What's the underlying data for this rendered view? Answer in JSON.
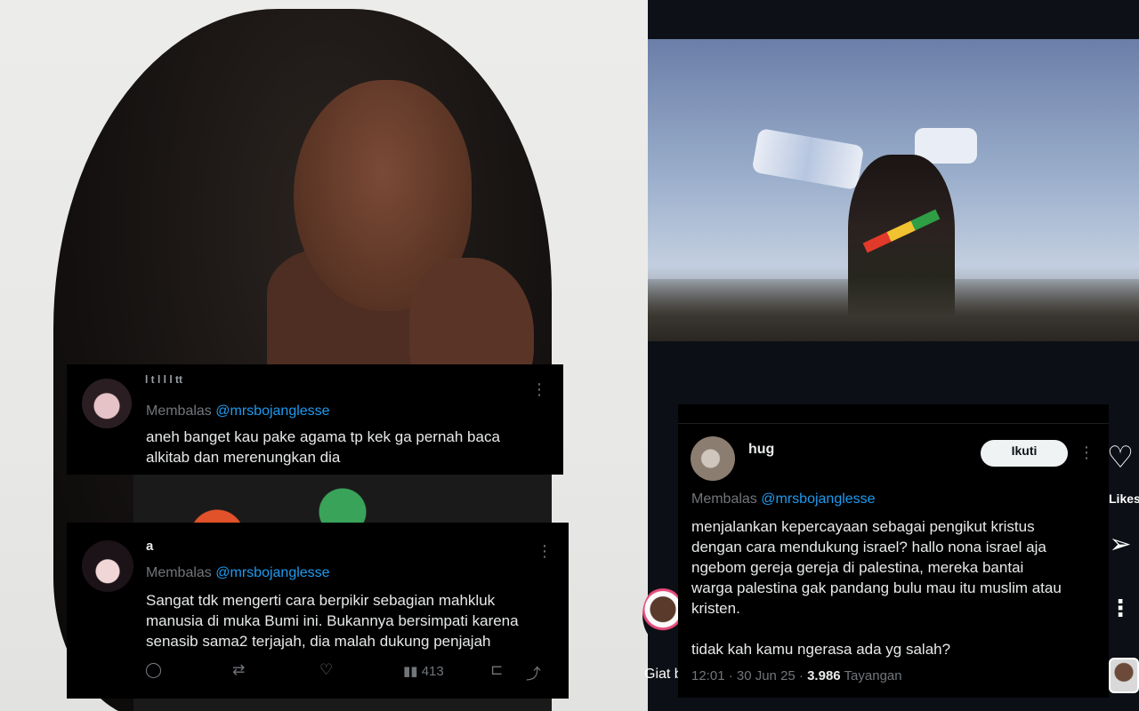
{
  "tweet1": {
    "name": "l      t    l      l   l     tt",
    "reply_prefix": "Membalas",
    "reply_handle": "@mrsbojanglesse",
    "body": "aneh banget kau pake agama tp kek ga pernah baca\nalkitab dan merenungkan dia"
  },
  "tweet2": {
    "name": "a",
    "reply_prefix": "Membalas",
    "reply_handle": "@mrsbojanglesse",
    "body": "Sangat tdk mengerti cara berpikir sebagian mahkluk\nmanusia di muka Bumi ini. Bukannya bersimpati karena\nsenasib sama2 terjajah, dia malah dukung penjajah",
    "views": "413"
  },
  "tweet3": {
    "name": "hug",
    "follow_label": "Ikuti",
    "reply_prefix": "Membalas",
    "reply_handle": "@mrsbojanglesse",
    "body": "menjalankan kepercayaan sebagai pengikut kristus\ndengan cara mendukung israel? hallo nona israel aja\nngebom gereja gereja di palestina, mereka bantai\nwarga palestina gak pandang bulu mau itu muslim atau\nkristen.\n\ntidak kah kamu ngerasa ada yg salah?",
    "time": "12:01 · 30 Jun 25 ·",
    "view_count": "3.986",
    "view_label": "Tayangan"
  },
  "side": {
    "likes_label": "Likes",
    "story_name": "Giat b"
  },
  "colors": {
    "background": "#000000",
    "text": "#e7e9ea",
    "muted": "#71767b",
    "link": "#1d9bf0"
  },
  "icons": [
    "more-icon",
    "reply-icon",
    "retweet-icon",
    "like-icon",
    "views-icon",
    "bookmark-icon",
    "share-icon",
    "heart-icon",
    "send-icon"
  ]
}
